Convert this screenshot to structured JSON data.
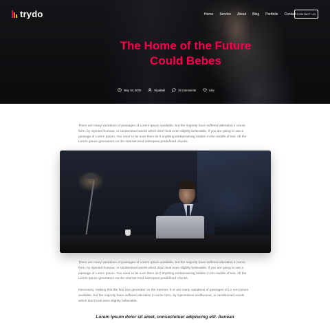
{
  "header": {
    "logo_text": "trydo",
    "nav": [
      "Home",
      "Service",
      "About",
      "Blog",
      "Portfolio",
      "Contact"
    ],
    "cta_label": "CONTACT US"
  },
  "hero": {
    "title_line1": "The Home of the Future",
    "title_line2": "Could Bebes",
    "meta": {
      "date": "May 18, 2020",
      "author": "NipaBali",
      "comments": "15 Comments",
      "like": "Like"
    }
  },
  "content": {
    "paragraph1": "There are many variations of passages of Lorem Ipsum available, but the majority have suffered alteration in some form, by injected humour, or randomised words which don't look even slightly believable. If you are going to use a passage of Lorem Ipsum. You need to be sure there isn't anything embarrassing hidden in the middle of text. All the Lorem Ipsum generators on the Internet tend toitrrepeat predefined chunks.",
    "paragraph2": "There are many variations of passages of Lorem Ipsum available, but the majority have suffered alteration in some form, by injected humour, or randomised words which don't look even slightly believable. If you are going to use a passage of Lorem Ipsum. You need to be sure there isn't anything embarrassing hidden in the middle of text. All the Lorem Ipsum generators on the Internet tend toitrrepeat predefined chunks.",
    "paragraph3": "Necessary, making this the first true generator on the Internet. It re are many variations of passages of Lo rem Ipsum available, but the majority have suffered alteration in some form, by injectedeed eedhumour, or randomised words which don't look even slightly believable.",
    "quote": "Lorem ipsum dolor sit amet, consectetuer adipiscing elit. Aenean"
  },
  "colors": {
    "accent": "#f9004d",
    "hero_bg": "#141518",
    "body_text": "#717173"
  }
}
